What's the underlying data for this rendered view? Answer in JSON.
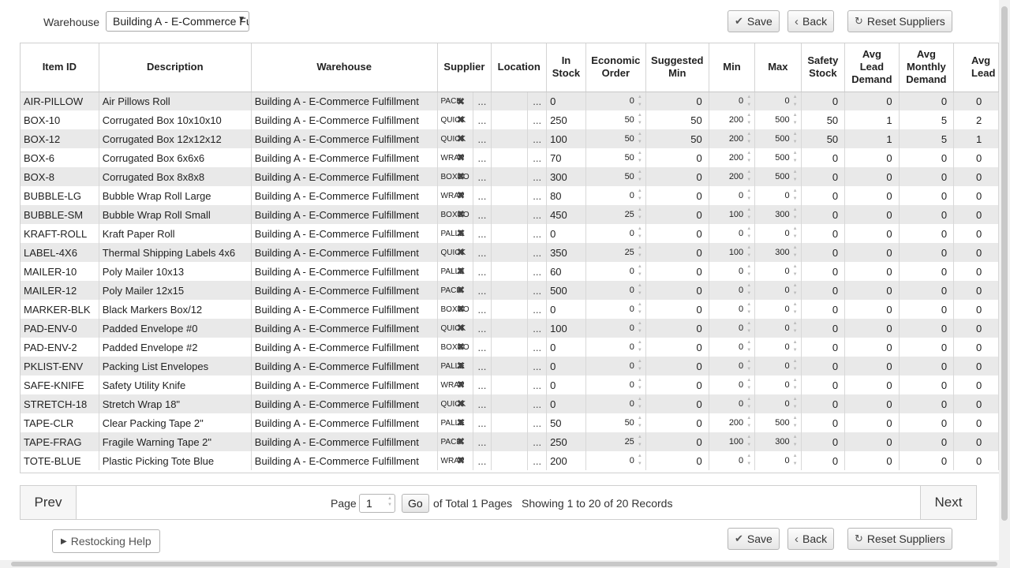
{
  "filters": {
    "warehouse_label": "Warehouse",
    "warehouse_value": "Building A - E-Commerce Fulfillment"
  },
  "toolbar": {
    "save": "Save",
    "back": "Back",
    "reset": "Reset Suppliers"
  },
  "columns": {
    "item_id": "Item ID",
    "description": "Description",
    "warehouse": "Warehouse",
    "supplier": "Supplier",
    "location": "Location",
    "in_stock": [
      "In",
      "Stock"
    ],
    "economic_order": [
      "Economic",
      "Order"
    ],
    "suggested_min": [
      "Suggested",
      "Min"
    ],
    "min": "Min",
    "max": "Max",
    "safety_stock": [
      "Safety",
      "Stock"
    ],
    "avg_lead_demand": [
      "Avg",
      "Lead",
      "Demand"
    ],
    "avg_monthly_demand": [
      "Avg",
      "Monthly",
      "Demand"
    ],
    "avg_lead": [
      "Avg",
      "Lead"
    ]
  },
  "rows": [
    {
      "id": "AIR-PILLOW",
      "desc": "Air Pillows Roll",
      "wh": "Building A - E-Commerce Fulfillment",
      "sup": "PACK",
      "loc_dots": "...",
      "stock": "0",
      "eco": "0",
      "smin": "0",
      "min": "0",
      "max": "0",
      "safety": "0",
      "ald": "0",
      "amd": "0",
      "al": "0"
    },
    {
      "id": "BOX-10",
      "desc": "Corrugated Box 10x10x10",
      "wh": "Building A - E-Commerce Fulfillment",
      "sup": "QUICK",
      "loc_dots": "...",
      "stock": "250",
      "eco": "50",
      "smin": "50",
      "min": "200",
      "max": "500",
      "safety": "50",
      "ald": "1",
      "amd": "5",
      "al": "2"
    },
    {
      "id": "BOX-12",
      "desc": "Corrugated Box 12x12x12",
      "wh": "Building A - E-Commerce Fulfillment",
      "sup": "QUICK",
      "loc_dots": "...",
      "stock": "100",
      "eco": "50",
      "smin": "50",
      "min": "200",
      "max": "500",
      "safety": "50",
      "ald": "1",
      "amd": "5",
      "al": "1"
    },
    {
      "id": "BOX-6",
      "desc": "Corrugated Box 6x6x6",
      "wh": "Building A - E-Commerce Fulfillment",
      "sup": "WRAP",
      "loc_dots": "...",
      "stock": "70",
      "eco": "50",
      "smin": "0",
      "min": "200",
      "max": "500",
      "safety": "0",
      "ald": "0",
      "amd": "0",
      "al": "0"
    },
    {
      "id": "BOX-8",
      "desc": "Corrugated Box 8x8x8",
      "wh": "Building A - E-Commerce Fulfillment",
      "sup": "BOXCO",
      "loc_dots": "...",
      "stock": "300",
      "eco": "50",
      "smin": "0",
      "min": "200",
      "max": "500",
      "safety": "0",
      "ald": "0",
      "amd": "0",
      "al": "0"
    },
    {
      "id": "BUBBLE-LG",
      "desc": "Bubble Wrap Roll Large",
      "wh": "Building A - E-Commerce Fulfillment",
      "sup": "WRAP",
      "loc_dots": "...",
      "stock": "80",
      "eco": "0",
      "smin": "0",
      "min": "0",
      "max": "0",
      "safety": "0",
      "ald": "0",
      "amd": "0",
      "al": "0"
    },
    {
      "id": "BUBBLE-SM",
      "desc": "Bubble Wrap Roll Small",
      "wh": "Building A - E-Commerce Fulfillment",
      "sup": "BOXCO",
      "loc_dots": "...",
      "stock": "450",
      "eco": "25",
      "smin": "0",
      "min": "100",
      "max": "300",
      "safety": "0",
      "ald": "0",
      "amd": "0",
      "al": "0"
    },
    {
      "id": "KRAFT-ROLL",
      "desc": "Kraft Paper Roll",
      "wh": "Building A - E-Commerce Fulfillment",
      "sup": "PALLE",
      "loc_dots": "...",
      "stock": "0",
      "eco": "0",
      "smin": "0",
      "min": "0",
      "max": "0",
      "safety": "0",
      "ald": "0",
      "amd": "0",
      "al": "0"
    },
    {
      "id": "LABEL-4X6",
      "desc": "Thermal Shipping Labels 4x6",
      "wh": "Building A - E-Commerce Fulfillment",
      "sup": "QUICK",
      "loc_dots": "...",
      "stock": "350",
      "eco": "25",
      "smin": "0",
      "min": "100",
      "max": "300",
      "safety": "0",
      "ald": "0",
      "amd": "0",
      "al": "0"
    },
    {
      "id": "MAILER-10",
      "desc": "Poly Mailer 10x13",
      "wh": "Building A - E-Commerce Fulfillment",
      "sup": "PALLE",
      "loc_dots": "...",
      "stock": "60",
      "eco": "0",
      "smin": "0",
      "min": "0",
      "max": "0",
      "safety": "0",
      "ald": "0",
      "amd": "0",
      "al": "0"
    },
    {
      "id": "MAILER-12",
      "desc": "Poly Mailer 12x15",
      "wh": "Building A - E-Commerce Fulfillment",
      "sup": "PACK",
      "loc_dots": "...",
      "stock": "500",
      "eco": "0",
      "smin": "0",
      "min": "0",
      "max": "0",
      "safety": "0",
      "ald": "0",
      "amd": "0",
      "al": "0"
    },
    {
      "id": "MARKER-BLK",
      "desc": "Black Markers Box/12",
      "wh": "Building A - E-Commerce Fulfillment",
      "sup": "BOXCO",
      "loc_dots": "...",
      "stock": "0",
      "eco": "0",
      "smin": "0",
      "min": "0",
      "max": "0",
      "safety": "0",
      "ald": "0",
      "amd": "0",
      "al": "0"
    },
    {
      "id": "PAD-ENV-0",
      "desc": "Padded Envelope #0",
      "wh": "Building A - E-Commerce Fulfillment",
      "sup": "QUICK",
      "loc_dots": "...",
      "stock": "100",
      "eco": "0",
      "smin": "0",
      "min": "0",
      "max": "0",
      "safety": "0",
      "ald": "0",
      "amd": "0",
      "al": "0"
    },
    {
      "id": "PAD-ENV-2",
      "desc": "Padded Envelope #2",
      "wh": "Building A - E-Commerce Fulfillment",
      "sup": "BOXCO",
      "loc_dots": "...",
      "stock": "0",
      "eco": "0",
      "smin": "0",
      "min": "0",
      "max": "0",
      "safety": "0",
      "ald": "0",
      "amd": "0",
      "al": "0"
    },
    {
      "id": "PKLIST-ENV",
      "desc": "Packing List Envelopes",
      "wh": "Building A - E-Commerce Fulfillment",
      "sup": "PALLE",
      "loc_dots": "...",
      "stock": "0",
      "eco": "0",
      "smin": "0",
      "min": "0",
      "max": "0",
      "safety": "0",
      "ald": "0",
      "amd": "0",
      "al": "0"
    },
    {
      "id": "SAFE-KNIFE",
      "desc": "Safety Utility Knife",
      "wh": "Building A - E-Commerce Fulfillment",
      "sup": "WRAP",
      "loc_dots": "...",
      "stock": "0",
      "eco": "0",
      "smin": "0",
      "min": "0",
      "max": "0",
      "safety": "0",
      "ald": "0",
      "amd": "0",
      "al": "0"
    },
    {
      "id": "STRETCH-18",
      "desc": "Stretch Wrap 18\"",
      "wh": "Building A - E-Commerce Fulfillment",
      "sup": "QUICK",
      "loc_dots": "...",
      "stock": "0",
      "eco": "0",
      "smin": "0",
      "min": "0",
      "max": "0",
      "safety": "0",
      "ald": "0",
      "amd": "0",
      "al": "0"
    },
    {
      "id": "TAPE-CLR",
      "desc": "Clear Packing Tape 2\"",
      "wh": "Building A - E-Commerce Fulfillment",
      "sup": "PALLE",
      "loc_dots": "...",
      "stock": "50",
      "eco": "50",
      "smin": "0",
      "min": "200",
      "max": "500",
      "safety": "0",
      "ald": "0",
      "amd": "0",
      "al": "0"
    },
    {
      "id": "TAPE-FRAG",
      "desc": "Fragile Warning Tape 2\"",
      "wh": "Building A - E-Commerce Fulfillment",
      "sup": "PACK",
      "loc_dots": "...",
      "stock": "250",
      "eco": "25",
      "smin": "0",
      "min": "100",
      "max": "300",
      "safety": "0",
      "ald": "0",
      "amd": "0",
      "al": "0"
    },
    {
      "id": "TOTE-BLUE",
      "desc": "Plastic Picking Tote Blue",
      "wh": "Building A - E-Commerce Fulfillment",
      "sup": "WRAP",
      "loc_dots": "...",
      "stock": "200",
      "eco": "0",
      "smin": "0",
      "min": "0",
      "max": "0",
      "safety": "0",
      "ald": "0",
      "amd": "0",
      "al": "0"
    }
  ],
  "pager": {
    "prev": "Prev",
    "next": "Next",
    "page_label": "Page",
    "page_value": "1",
    "go": "Go",
    "total": "of Total 1 Pages",
    "showing": "Showing 1 to 20 of 20 Records"
  },
  "help": {
    "label": "Restocking Help"
  },
  "icons": {
    "save": "check-icon",
    "back": "chevron-left-icon",
    "reset": "refresh-icon",
    "help": "triangle-right-icon",
    "supplier_clear": "x-icon"
  }
}
